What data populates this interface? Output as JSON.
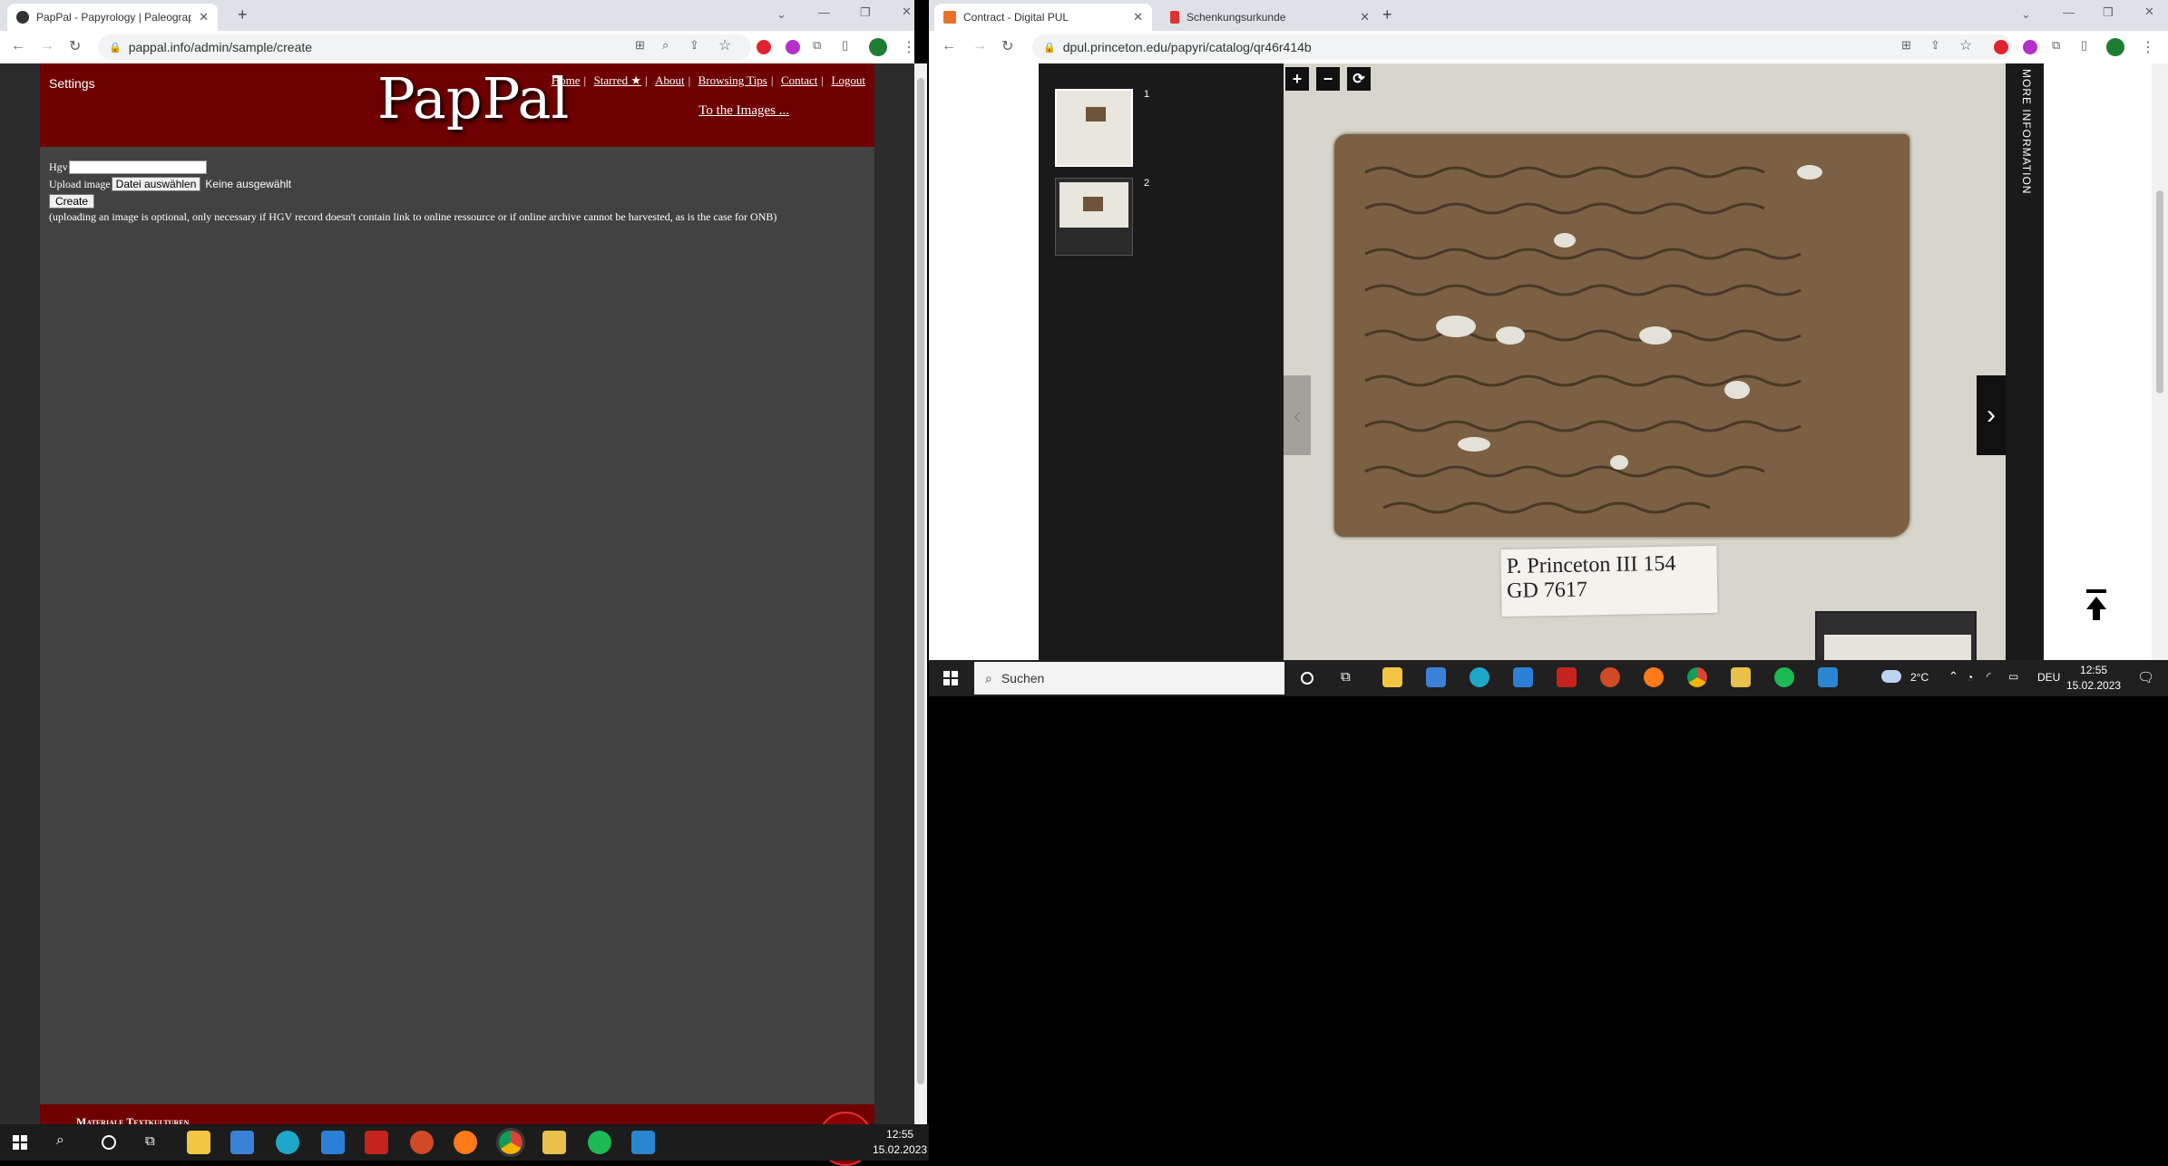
{
  "left_browser": {
    "tabs": [
      {
        "title": "PapPal - Papyrology | Paleograph",
        "active": true
      }
    ],
    "url": "pappal.info/admin/sample/create"
  },
  "pappal": {
    "settings_label": "Settings",
    "logo": "PapPal",
    "nav": [
      "Home",
      "Starred ★",
      "About",
      "Browsing Tips",
      "Contact",
      "Logout"
    ],
    "to_images": "To the Images ...",
    "form": {
      "hgv_label": "Hgv",
      "hgv_value": "",
      "upload_label": "Upload image",
      "file_button": "Datei auswählen",
      "file_status": "Keine ausgewählt",
      "create_button": "Create",
      "note": "(uploading an image is optional, only necessary if HGV record doesn't contain link to online ressource or if online archive cannot be harvested, as is the case for ONB)"
    },
    "footer_text": "Materiale Textkulturen"
  },
  "right_browser": {
    "tabs": [
      {
        "title": "Contract - Digital PUL",
        "active": true
      },
      {
        "title": "Schenkungsurkunde",
        "active": false
      }
    ],
    "url": "dpul.princeton.edu/papyri/catalog/qr46r414b"
  },
  "viewer": {
    "thumbnails": [
      {
        "page": "1"
      },
      {
        "page": "2"
      }
    ],
    "zoom_in": "+",
    "zoom_out": "−",
    "rotate": "⟳",
    "label_line1": "P. Princeton III 154",
    "label_line2": "GD 7617",
    "more_information": "MORE INFORMATION"
  },
  "taskbar_small": {
    "time": "12:55",
    "date": "15.02.2023",
    "search_placeholder": "Suchen",
    "weather": "2°C",
    "language": "DEU"
  },
  "taskbar_main": {
    "time": "12:55",
    "date": "15.02.2023"
  }
}
